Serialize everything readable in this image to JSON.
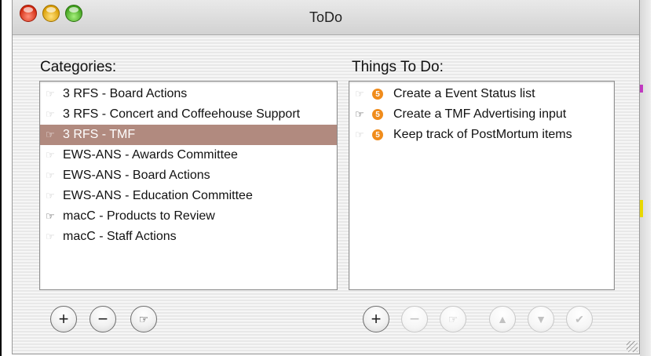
{
  "window": {
    "title": "ToDo"
  },
  "categories": {
    "label": "Categories:",
    "items": [
      {
        "label": "3 RFS - Board Actions",
        "active": false,
        "selected": false
      },
      {
        "label": "3 RFS - Concert and Coffeehouse Support",
        "active": false,
        "selected": false
      },
      {
        "label": "3 RFS - TMF",
        "active": false,
        "selected": true
      },
      {
        "label": "EWS-ANS - Awards Committee",
        "active": false,
        "selected": false
      },
      {
        "label": "EWS-ANS - Board Actions",
        "active": false,
        "selected": false
      },
      {
        "label": "EWS-ANS - Education Committee",
        "active": false,
        "selected": false
      },
      {
        "label": "macC - Products to Review",
        "active": true,
        "selected": false
      },
      {
        "label": "macC - Staff Actions",
        "active": false,
        "selected": false
      }
    ],
    "buttons": {
      "add": "+",
      "remove": "−"
    }
  },
  "todo": {
    "label": "Things To Do:",
    "items": [
      {
        "label": "Create a Event Status list",
        "priority": "5",
        "active": false
      },
      {
        "label": "Create a TMF Advertising input",
        "priority": "5",
        "active": true
      },
      {
        "label": "Keep track of PostMortum items",
        "priority": "5",
        "active": false
      }
    ],
    "buttons": {
      "add": "+",
      "remove": "−",
      "up": "▲",
      "down": "▼",
      "done": "✔"
    }
  },
  "icons": {
    "hand": "☞",
    "priority_color": "#f08c1c",
    "selection_color": "#b18a7f"
  }
}
